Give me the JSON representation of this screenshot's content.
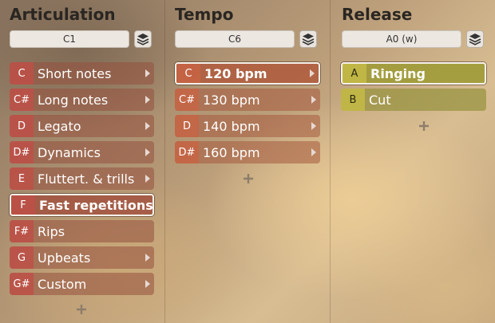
{
  "columns": [
    {
      "title": "Articulation",
      "preset": "C1",
      "items": [
        {
          "key": "C",
          "label": "Short notes",
          "arrow": true,
          "selected": false
        },
        {
          "key": "C#",
          "label": "Long notes",
          "arrow": true,
          "selected": false
        },
        {
          "key": "D",
          "label": "Legato",
          "arrow": true,
          "selected": false
        },
        {
          "key": "D#",
          "label": "Dynamics",
          "arrow": true,
          "selected": false
        },
        {
          "key": "E",
          "label": "Fluttert. & trills",
          "arrow": true,
          "selected": false
        },
        {
          "key": "F",
          "label": "Fast repetitions",
          "arrow": true,
          "selected": true
        },
        {
          "key": "F#",
          "label": "Rips",
          "arrow": false,
          "selected": false
        },
        {
          "key": "G",
          "label": "Upbeats",
          "arrow": true,
          "selected": false
        },
        {
          "key": "G#",
          "label": "Custom",
          "arrow": true,
          "selected": false
        }
      ]
    },
    {
      "title": "Tempo",
      "preset": "C6",
      "items": [
        {
          "key": "C",
          "label": "120 bpm",
          "arrow": true,
          "selected": true
        },
        {
          "key": "C#",
          "label": "130 bpm",
          "arrow": true,
          "selected": false
        },
        {
          "key": "D",
          "label": "140 bpm",
          "arrow": true,
          "selected": false
        },
        {
          "key": "D#",
          "label": "160 bpm",
          "arrow": true,
          "selected": false
        }
      ]
    },
    {
      "title": "Release",
      "preset": "A0 (w)",
      "items": [
        {
          "key": "A",
          "label": "Ringing",
          "arrow": false,
          "selected": true
        },
        {
          "key": "B",
          "label": "Cut",
          "arrow": false,
          "selected": false
        }
      ]
    }
  ],
  "icons": {
    "preset_menu": "layers-icon",
    "submenu": "chevron-right-icon",
    "add": "plus-icon"
  },
  "colors": {
    "articulation_key": "#be5048",
    "tempo_key": "#c8643f",
    "release_key": "#c3b946"
  }
}
